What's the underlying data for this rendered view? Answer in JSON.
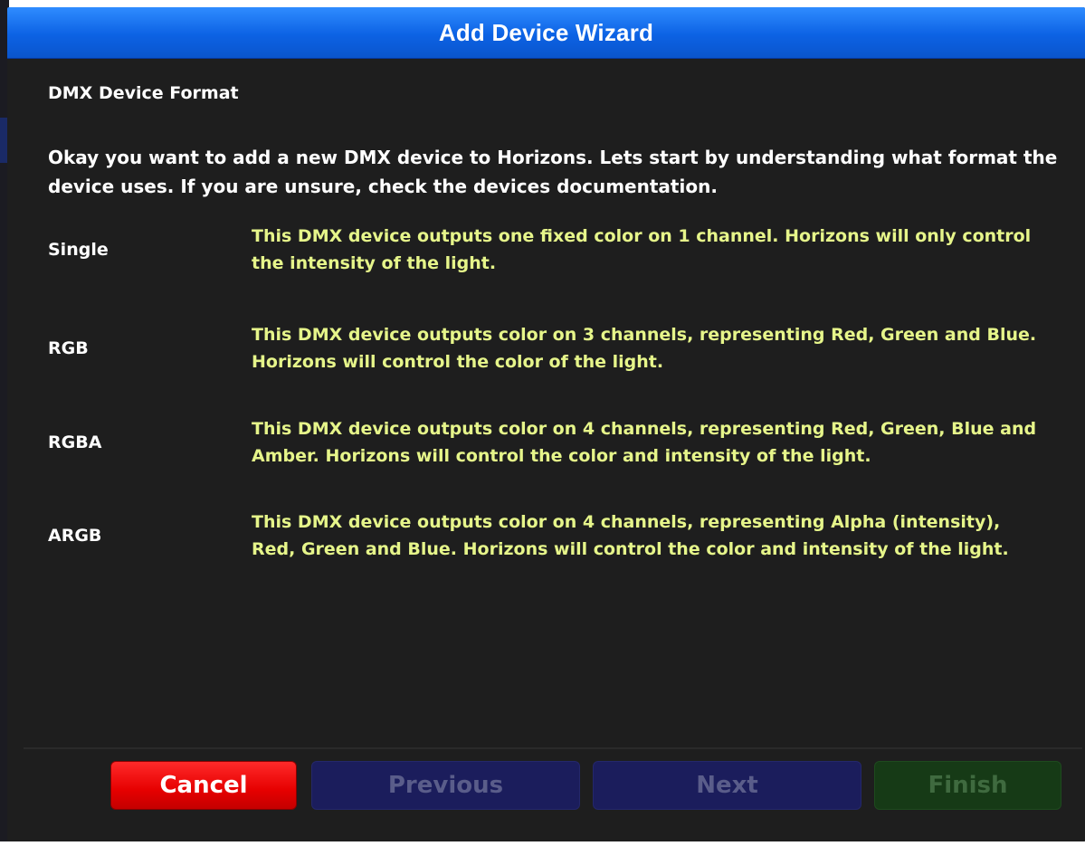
{
  "window": {
    "title": "Add Device Wizard"
  },
  "page": {
    "subtitle": "DMX Device Format",
    "intro": "Okay you want to add a new DMX device to Horizons. Lets start by understanding what format the device uses. If you are unsure, check the devices documentation."
  },
  "formats": [
    {
      "name": "Single",
      "description": "This DMX device outputs one fixed color on 1 channel. Horizons will only control the intensity of the light."
    },
    {
      "name": "RGB",
      "description": "This DMX device outputs color on 3 channels, representing Red, Green and Blue. Horizons will control the color of the light."
    },
    {
      "name": "RGBA",
      "description": "This DMX device outputs color on 4 channels, representing Red, Green, Blue and Amber. Horizons will control the color and intensity of the light."
    },
    {
      "name": "ARGB",
      "description": "This DMX device outputs color on 4 channels, representing Alpha (intensity), Red, Green and Blue. Horizons will control the color and intensity of the light."
    }
  ],
  "buttons": {
    "cancel": "Cancel",
    "previous": "Previous",
    "next": "Next",
    "finish": "Finish"
  },
  "colors": {
    "titlebar": "#0c62e4",
    "background": "#1e1e1e",
    "description_text": "#e6f58a",
    "cancel": "#e60000",
    "previous_disabled": "#1b1d5c",
    "next_disabled": "#1b1d5c",
    "finish_disabled": "#163a16"
  }
}
